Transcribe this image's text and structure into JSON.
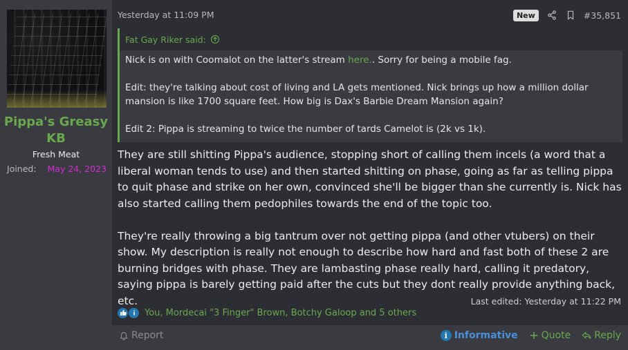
{
  "user": {
    "name": "Pippa's Greasy KB",
    "title": "Fresh Meat",
    "joined_label": "Joined:",
    "joined_date": "May 24, 2023",
    "avatar_icon": "keyboard-avatar-image"
  },
  "post": {
    "date": "Yesterday at 11:09 PM",
    "new_badge": "New",
    "number": "#35,851",
    "icons": {
      "share": "share-icon",
      "bookmark": "bookmark-icon"
    }
  },
  "quote": {
    "author": "Fat Gay Riker said:",
    "line1_pre": "Nick is on with Coomalot on the latter's stream ",
    "line1_link": "here.",
    "line1_post": ". Sorry for being a mobile fag.",
    "line2": "Edit: they're talking about cost of living and LA gets mentioned. Nick brings up how a million dollar mansion is like 1700 square feet. How big is Dax's Barbie Dream Mansion again?",
    "line3": "Edit 2: Pippa is streaming to twice the number of tards Camelot is (2k vs 1k)."
  },
  "body": {
    "para1": "They are still shitting Pippa's audience, stopping short of calling them incels (a word that a liberal woman tends to use) and then started shitting on phase, going as far as telling pippa to quit phase and strike on her own, convinced she'll be bigger than she currently is. Nick has also started calling them pedophiles towards the end of the topic too.",
    "para2": "They're really throwing a big tantrum over not getting pippa (and other vtubers) on their show. My description is really not enough to describe how hard and fast both of these 2 are burning bridges with phase. They are lambasting phase really hard, calling it predatory, saying pippa is barely getting paid after the cuts but they dont really provide anything back, etc."
  },
  "last_edited": "Last edited: Yesterday at 11:22 PM",
  "reactions": {
    "text": "You, Mordecai \"3 Finger\" Brown, Botchy Galoop and 5 others"
  },
  "footer": {
    "report": "Report",
    "informative": "Informative",
    "quote": "Quote",
    "reply": "Reply"
  },
  "colors": {
    "accent_green": "#6aa84f",
    "joined_magenta": "#d52ad4",
    "informative_blue": "#4a90d9"
  }
}
